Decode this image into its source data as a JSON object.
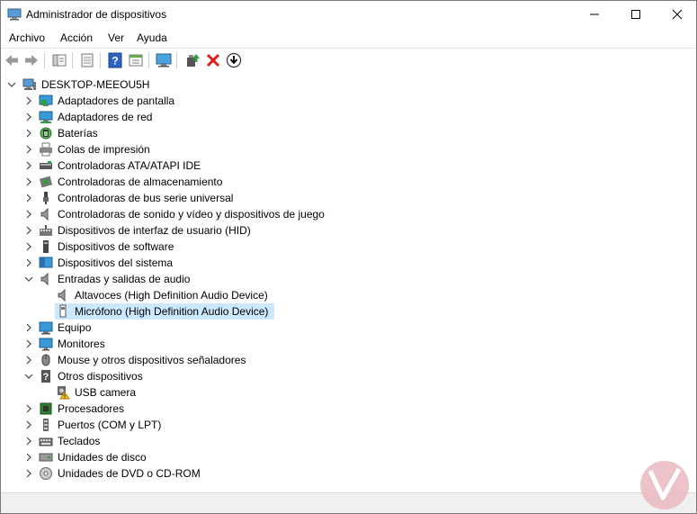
{
  "window": {
    "title": "Administrador de dispositivos"
  },
  "menu": [
    {
      "label": "Archivo"
    },
    {
      "label": "Acción"
    },
    {
      "label": "Ver"
    },
    {
      "label": "Ayuda"
    }
  ],
  "toolbar": {
    "buttons": [
      "back-icon",
      "forward-icon",
      "properties-pane-icon",
      "driver-icon",
      "help-icon",
      "update-pane-icon",
      "monitor-scan-icon",
      "add-driver-icon",
      "remove-device-icon",
      "download-icon"
    ]
  },
  "tree": {
    "root": "DESKTOP-MEEOU5H",
    "categories": [
      {
        "label": "Adaptadores de pantalla"
      },
      {
        "label": "Adaptadores de red"
      },
      {
        "label": "Baterías"
      },
      {
        "label": "Colas de impresión"
      },
      {
        "label": "Controladoras ATA/ATAPI IDE"
      },
      {
        "label": "Controladoras de almacenamiento"
      },
      {
        "label": "Controladoras de bus serie universal"
      },
      {
        "label": "Controladoras de sonido y vídeo y dispositivos de juego"
      },
      {
        "label": "Dispositivos de interfaz de usuario (HID)"
      },
      {
        "label": "Dispositivos de software"
      },
      {
        "label": "Dispositivos del sistema"
      },
      {
        "label": "Entradas y salidas de audio",
        "children": [
          "Altavoces (High Definition Audio Device)",
          "Micrófono (High Definition Audio Device)"
        ]
      },
      {
        "label": "Equipo"
      },
      {
        "label": "Monitores"
      },
      {
        "label": "Mouse y otros dispositivos señaladores"
      },
      {
        "label": "Otros dispositivos",
        "children": [
          "USB camera"
        ]
      },
      {
        "label": "Procesadores"
      },
      {
        "label": "Puertos (COM y LPT)"
      },
      {
        "label": "Teclados"
      },
      {
        "label": "Unidades de disco"
      },
      {
        "label": "Unidades de DVD o CD-ROM"
      }
    ]
  },
  "colors": {
    "selection": "#cce8ff",
    "accent": "#0078d7"
  }
}
